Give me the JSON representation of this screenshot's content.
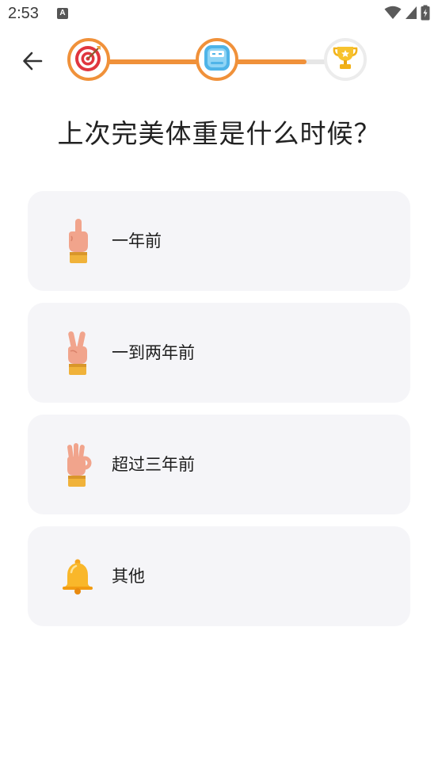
{
  "status_bar": {
    "time": "2:53",
    "notification_icon": "app-notification-icon",
    "wifi_icon": "wifi-icon",
    "signal_icon": "signal-icon",
    "battery_icon": "battery-charging-icon"
  },
  "nav": {
    "back_icon": "arrow-left-icon"
  },
  "progress": {
    "fill_fraction": 0.84,
    "steps": [
      {
        "icon": "target-icon",
        "state": "active"
      },
      {
        "icon": "scale-icon",
        "state": "active"
      },
      {
        "icon": "trophy-icon",
        "state": "inactive"
      }
    ],
    "accent_color": "#f0913a",
    "track_color": "#e6e6e6"
  },
  "question": {
    "title": "上次完美体重是什么时候？"
  },
  "options": [
    {
      "label": "一年前",
      "icon": "index-finger-up-icon"
    },
    {
      "label": "一到两年前",
      "icon": "victory-hand-icon"
    },
    {
      "label": "超过三年前",
      "icon": "ok-hand-icon"
    },
    {
      "label": "其他",
      "icon": "bell-icon"
    }
  ]
}
